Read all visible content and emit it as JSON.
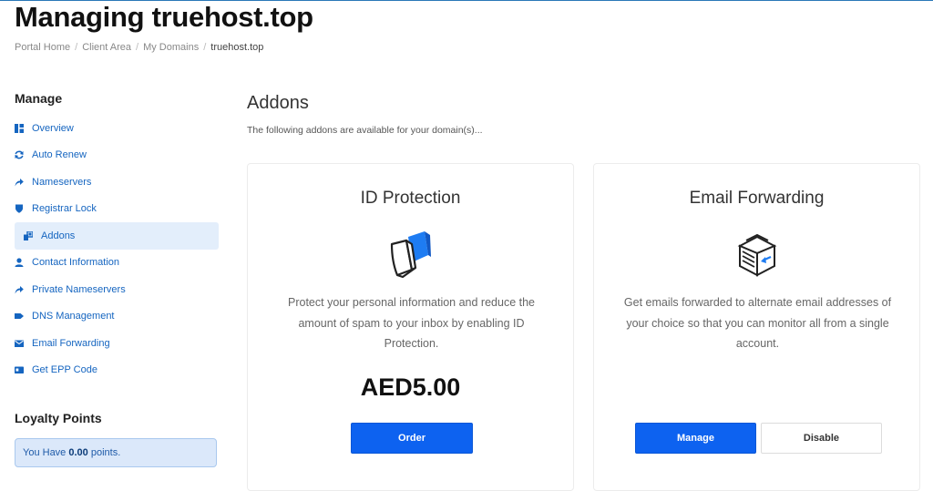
{
  "page": {
    "title": "Managing truehost.top"
  },
  "breadcrumb": [
    "Portal Home",
    "Client Area",
    "My Domains",
    "truehost.top"
  ],
  "sidebar": {
    "heading": "Manage",
    "items": [
      {
        "label": "Overview",
        "icon": "dashboard-icon"
      },
      {
        "label": "Auto Renew",
        "icon": "sync-icon"
      },
      {
        "label": "Nameservers",
        "icon": "share-arrow-icon"
      },
      {
        "label": "Registrar Lock",
        "icon": "shield-icon"
      },
      {
        "label": "Addons",
        "icon": "cubes-icon",
        "active": true
      },
      {
        "label": "Contact Information",
        "icon": "user-icon"
      },
      {
        "label": "Private Nameservers",
        "icon": "share-arrow-icon"
      },
      {
        "label": "DNS Management",
        "icon": "tag-icon"
      },
      {
        "label": "Email Forwarding",
        "icon": "envelope-icon"
      },
      {
        "label": "Get EPP Code",
        "icon": "id-card-icon"
      }
    ],
    "loyalty": {
      "heading": "Loyalty Points",
      "prefix": "You Have",
      "points": "0.00",
      "suffix": "points."
    }
  },
  "main": {
    "title": "Addons",
    "subtitle": "The following addons are available for your domain(s)...",
    "cards": [
      {
        "title": "ID Protection",
        "icon": "id-protection-shield-icon",
        "description": "Protect your personal information and reduce the amount of spam to your inbox by enabling ID Protection.",
        "price": "AED5.00",
        "order_label": "Order"
      },
      {
        "title": "Email Forwarding",
        "icon": "email-forwarding-box-icon",
        "description": "Get emails forwarded to alternate email addresses of your choice so that you can monitor all from a single account.",
        "manage_label": "Manage",
        "disable_label": "Disable"
      }
    ]
  },
  "colors": {
    "link": "#1565c0",
    "primary_button": "#0d62f0",
    "active_bg": "#e3eefb",
    "points_bg": "#dbe8fa"
  }
}
